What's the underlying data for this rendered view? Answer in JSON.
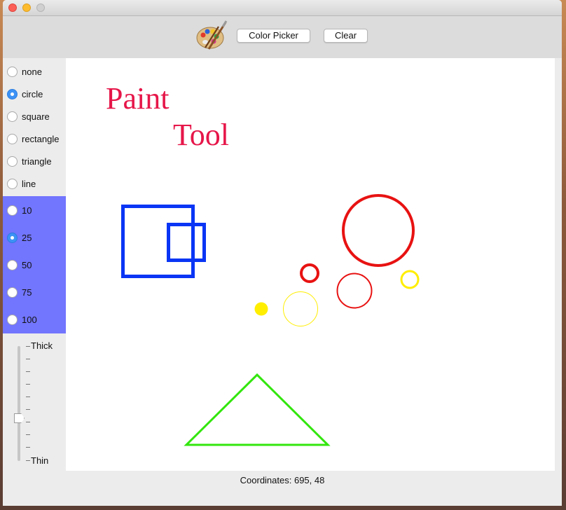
{
  "window": {
    "toolbar": {
      "palette_icon": "palette-icon",
      "color_picker_label": "Color Picker",
      "clear_label": "Clear"
    }
  },
  "shape_options": [
    {
      "label": "none",
      "selected": false
    },
    {
      "label": "circle",
      "selected": true
    },
    {
      "label": "square",
      "selected": false
    },
    {
      "label": "rectangle",
      "selected": false
    },
    {
      "label": "triangle",
      "selected": false
    },
    {
      "label": "line",
      "selected": false
    }
  ],
  "size_options": [
    {
      "label": "10",
      "selected": false
    },
    {
      "label": "25",
      "selected": true
    },
    {
      "label": "50",
      "selected": false
    },
    {
      "label": "75",
      "selected": false
    },
    {
      "label": "100",
      "selected": false
    }
  ],
  "size_panel_color": "#7275fd",
  "thickness": {
    "max_label": "Thick",
    "min_label": "Thin",
    "value_fraction": 0.35
  },
  "canvas": {
    "title_line1": "Paint",
    "title_line2": "Tool",
    "title_color": "#e61649",
    "colors": {
      "blue": "#0a35f5",
      "red": "#e81212",
      "yellow": "#ffee00",
      "green": "#33e60e"
    }
  },
  "status": {
    "coordinates": "Coordinates: 695, 48"
  }
}
